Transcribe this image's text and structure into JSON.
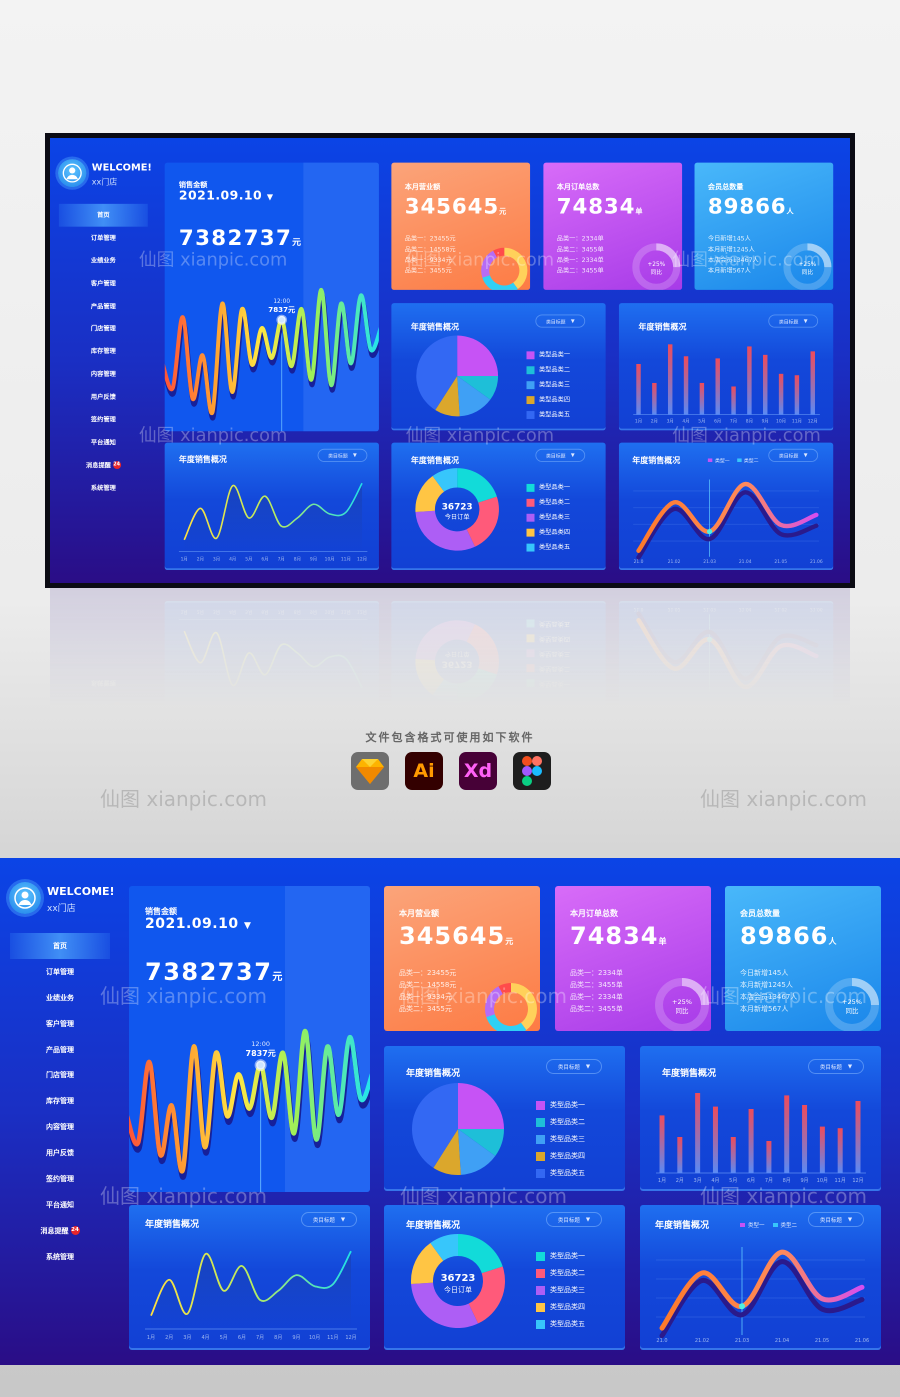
{
  "watermark": "仙图 xianpic.com",
  "software": {
    "title": "文件包含格式可使用如下软件",
    "apps": [
      {
        "name": "Sketch",
        "icon": "sketch-icon"
      },
      {
        "name": "Ai",
        "icon": "illustrator-icon"
      },
      {
        "name": "Xd",
        "icon": "xd-icon"
      },
      {
        "name": "Figma",
        "icon": "figma-icon"
      }
    ]
  },
  "sidebar": {
    "welcome": "WELCOME!",
    "shop": "xx门店",
    "items": [
      {
        "label": "首页",
        "active": true
      },
      {
        "label": "订单管理"
      },
      {
        "label": "业绩业务"
      },
      {
        "label": "客户管理"
      },
      {
        "label": "产品管理"
      },
      {
        "label": "门店管理"
      },
      {
        "label": "库存管理"
      },
      {
        "label": "内容管理"
      },
      {
        "label": "用户反馈"
      },
      {
        "label": "签约管理"
      },
      {
        "label": "平台通知"
      },
      {
        "label": "消息提醒",
        "badge": "24"
      },
      {
        "label": "系统管理"
      }
    ]
  },
  "sales": {
    "label": "销售金额",
    "date": "2021.09.10",
    "total": "7382737",
    "unit": "元",
    "tooltip_time": "12:00",
    "tooltip_value": "7837元"
  },
  "kpis": [
    {
      "title": "本月营业额",
      "value": "345645",
      "unit": "元",
      "lines": [
        "品类一：23455元",
        "品类二：14558元",
        "品类一：9334元",
        "品类二：3455元"
      ]
    },
    {
      "title": "本月订单总数",
      "value": "74834",
      "unit": "单",
      "lines": [
        "品类一：2334单",
        "品类二：3455单",
        "品类一：2334单",
        "品类二：3455单"
      ],
      "ring_top": "+25%",
      "ring_bottom": "同比",
      "ring_percent": 25
    },
    {
      "title": "会员总数量",
      "value": "89866",
      "unit": "人",
      "lines": [
        "今日新增145人",
        "本月新增1245人",
        "本店会员13467人",
        "本月新增567人"
      ],
      "ring_top": "+25%",
      "ring_bottom": "同比",
      "ring_percent": 25
    }
  ],
  "panels": {
    "title": "年度销售概况",
    "dropdown": "类目标题"
  },
  "colors": {
    "accent": "#1057ee",
    "orange": "#fd7b44",
    "purple": "#a73be8",
    "blue": "#1a86ea"
  },
  "chart_data": [
    {
      "id": "sales-wave",
      "type": "line",
      "values": [
        45,
        28,
        80,
        20,
        52,
        10,
        90,
        25,
        86,
        45,
        72,
        50,
        78,
        44,
        86,
        34,
        100,
        30,
        90,
        46,
        96,
        56,
        72
      ],
      "highlight_index": 12
    },
    {
      "id": "kpi-donut",
      "type": "pie",
      "values": [
        40,
        30,
        22,
        8
      ],
      "colors": [
        "#ffd15a",
        "#2fd0f5",
        "#b66cf5",
        "#ff4b4b"
      ]
    },
    {
      "id": "pie",
      "type": "pie",
      "title": "年度销售概况",
      "categories": [
        "类型品类一",
        "类型品类二",
        "类型品类三",
        "类型品类四",
        "类型品类五"
      ],
      "values": [
        25,
        10,
        14,
        10,
        41
      ],
      "colors": [
        "#c653f5",
        "#1ebfd8",
        "#3fa0f5",
        "#dba72c",
        "#3368f3"
      ]
    },
    {
      "id": "bar",
      "type": "bar",
      "title": "年度销售概况",
      "categories": [
        "1月",
        "2月",
        "3月",
        "4月",
        "5月",
        "6月",
        "7月",
        "8月",
        "9月",
        "10月",
        "11月",
        "12月"
      ],
      "values": [
        72,
        45,
        100,
        83,
        45,
        80,
        40,
        97,
        85,
        58,
        56,
        90
      ]
    },
    {
      "id": "line-month",
      "type": "area",
      "title": "年度销售概况",
      "categories": [
        "1月",
        "2月",
        "3月",
        "4月",
        "5月",
        "6月",
        "7月",
        "8月",
        "9月",
        "10月",
        "11月",
        "12月"
      ],
      "values": [
        8,
        47,
        10,
        75,
        35,
        62,
        25,
        35,
        52,
        40,
        42,
        78
      ]
    },
    {
      "id": "donut",
      "type": "pie",
      "title": "年度销售概况",
      "center_value": "36723",
      "center_label": "今日订单",
      "categories": [
        "类型品类一",
        "类型品类二",
        "类型品类三",
        "类型品类四",
        "类型品类五"
      ],
      "values": [
        20,
        23,
        31,
        16,
        10
      ],
      "colors": [
        "#12dbd9",
        "#ff5a7a",
        "#ad5ef5",
        "#ffc544",
        "#37c6fb"
      ]
    },
    {
      "id": "line-dual",
      "type": "line",
      "title": "年度销售概况",
      "categories": [
        "21.0",
        "21.02",
        "21.03",
        "21.04",
        "21.05",
        "21.06"
      ],
      "series": [
        {
          "name": "类型一",
          "values": [
            2,
            60,
            25,
            82,
            33,
            45
          ],
          "color": "#c653f5"
        },
        {
          "name": "类型二",
          "values": [
            -6,
            52,
            16,
            72,
            22,
            32
          ],
          "color": "#37c6fb"
        }
      ],
      "highlight_index": 2
    }
  ]
}
